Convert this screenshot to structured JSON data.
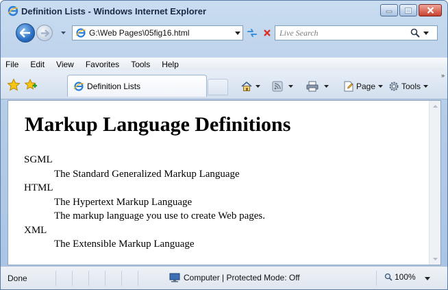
{
  "window": {
    "title": "Definition Lists - Windows Internet Explorer"
  },
  "nav": {
    "address": "G:\\Web Pages\\05fig16.html",
    "search_placeholder": "Live Search"
  },
  "menu": [
    "File",
    "Edit",
    "View",
    "Favorites",
    "Tools",
    "Help"
  ],
  "tab": {
    "label": "Definition Lists"
  },
  "commands": {
    "page_label": "Page",
    "tools_label": "Tools"
  },
  "page": {
    "heading": "Markup Language Definitions",
    "definitions": [
      {
        "term": "SGML",
        "descriptions": [
          "The Standard Generalized Markup Language"
        ]
      },
      {
        "term": "HTML",
        "descriptions": [
          "The Hypertext Markup Language",
          "The markup language you use to create Web pages."
        ]
      },
      {
        "term": "XML",
        "descriptions": [
          "The Extensible Markup Language"
        ]
      }
    ]
  },
  "status": {
    "text": "Done",
    "zone": "Computer | Protected Mode: Off",
    "zoom": "100%"
  }
}
